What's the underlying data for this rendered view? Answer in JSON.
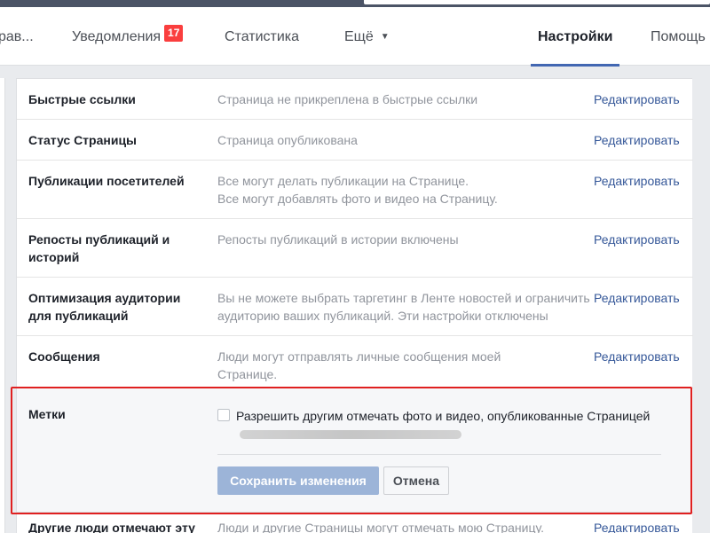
{
  "topnav": {
    "tabs": [
      {
        "label": "рав..."
      },
      {
        "label": "Уведомления",
        "badge": "17"
      },
      {
        "label": "Статистика"
      },
      {
        "label": "Ещё",
        "caret": "▼"
      },
      {
        "label": "Настройки"
      },
      {
        "label": "Помощь"
      }
    ]
  },
  "settings": {
    "rows": [
      {
        "label": "Быстрые ссылки",
        "desc": "Страница не прикреплена в быстрые ссылки",
        "action": "Редактировать"
      },
      {
        "label": "Статус Страницы",
        "desc": "Страница опубликована",
        "action": "Редактировать"
      },
      {
        "label": "Публикации посетителей",
        "desc": "Все могут делать публикации на Странице.\nВсе могут добавлять фото и видео на Страницу.",
        "action": "Редактировать"
      },
      {
        "label": "Репосты публикаций и историй",
        "desc": "Репосты публикаций в истории включены",
        "action": "Редактировать"
      },
      {
        "label": "Оптимизация аудитории для публикаций",
        "desc": "Вы не можете выбрать таргетинг в Ленте новостей и ограничить аудиторию ваших публикаций. Эти настройки отключены",
        "action": "Редактировать"
      },
      {
        "label": "Сообщения",
        "desc": "Люди могут отправлять личные сообщения моей Странице.",
        "action": "Редактировать"
      }
    ],
    "tags": {
      "label": "Метки",
      "checkbox_text": "Разрешить другим отмечать фото и видео, опубликованные Страницей",
      "checkbox_checked": false,
      "save_label": "Сохранить изменения",
      "cancel_label": "Отмена"
    },
    "last_row": {
      "label": "Другие люди отмечают эту",
      "desc": "Люди и другие Страницы могут отмечать мою Страницу.",
      "action": "Редактировать"
    }
  },
  "colors": {
    "accent": "#4267b2",
    "link": "#365899",
    "highlight": "#e02020",
    "badge": "#fa3e3e"
  }
}
